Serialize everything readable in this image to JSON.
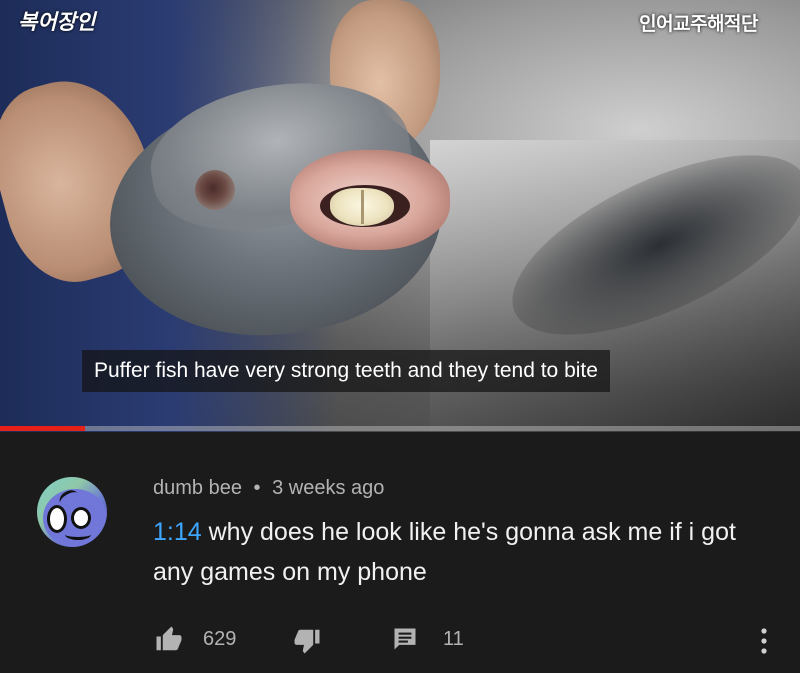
{
  "video": {
    "channel_logo_text": "복어장인",
    "channel_name": "인어교주해적단",
    "subtitle": "Puffer fish have very strong teeth and they tend to bite",
    "progress_percent": 10.6,
    "colors": {
      "progress": "#e62117"
    }
  },
  "comment": {
    "author": "dumb bee",
    "separator": "•",
    "time_ago": "3 weeks ago",
    "timestamp_link": "1:14",
    "text": " why does he look like he's gonna ask me if i got any games on my phone",
    "likes": "629",
    "replies": "11",
    "icons": [
      "thumbs-up-icon",
      "thumbs-down-icon",
      "reply-comment-icon",
      "more-vert-icon"
    ],
    "colors": {
      "link": "#3ea6ff",
      "text": "#f1f1f1",
      "meta": "#b3b3b3"
    }
  }
}
